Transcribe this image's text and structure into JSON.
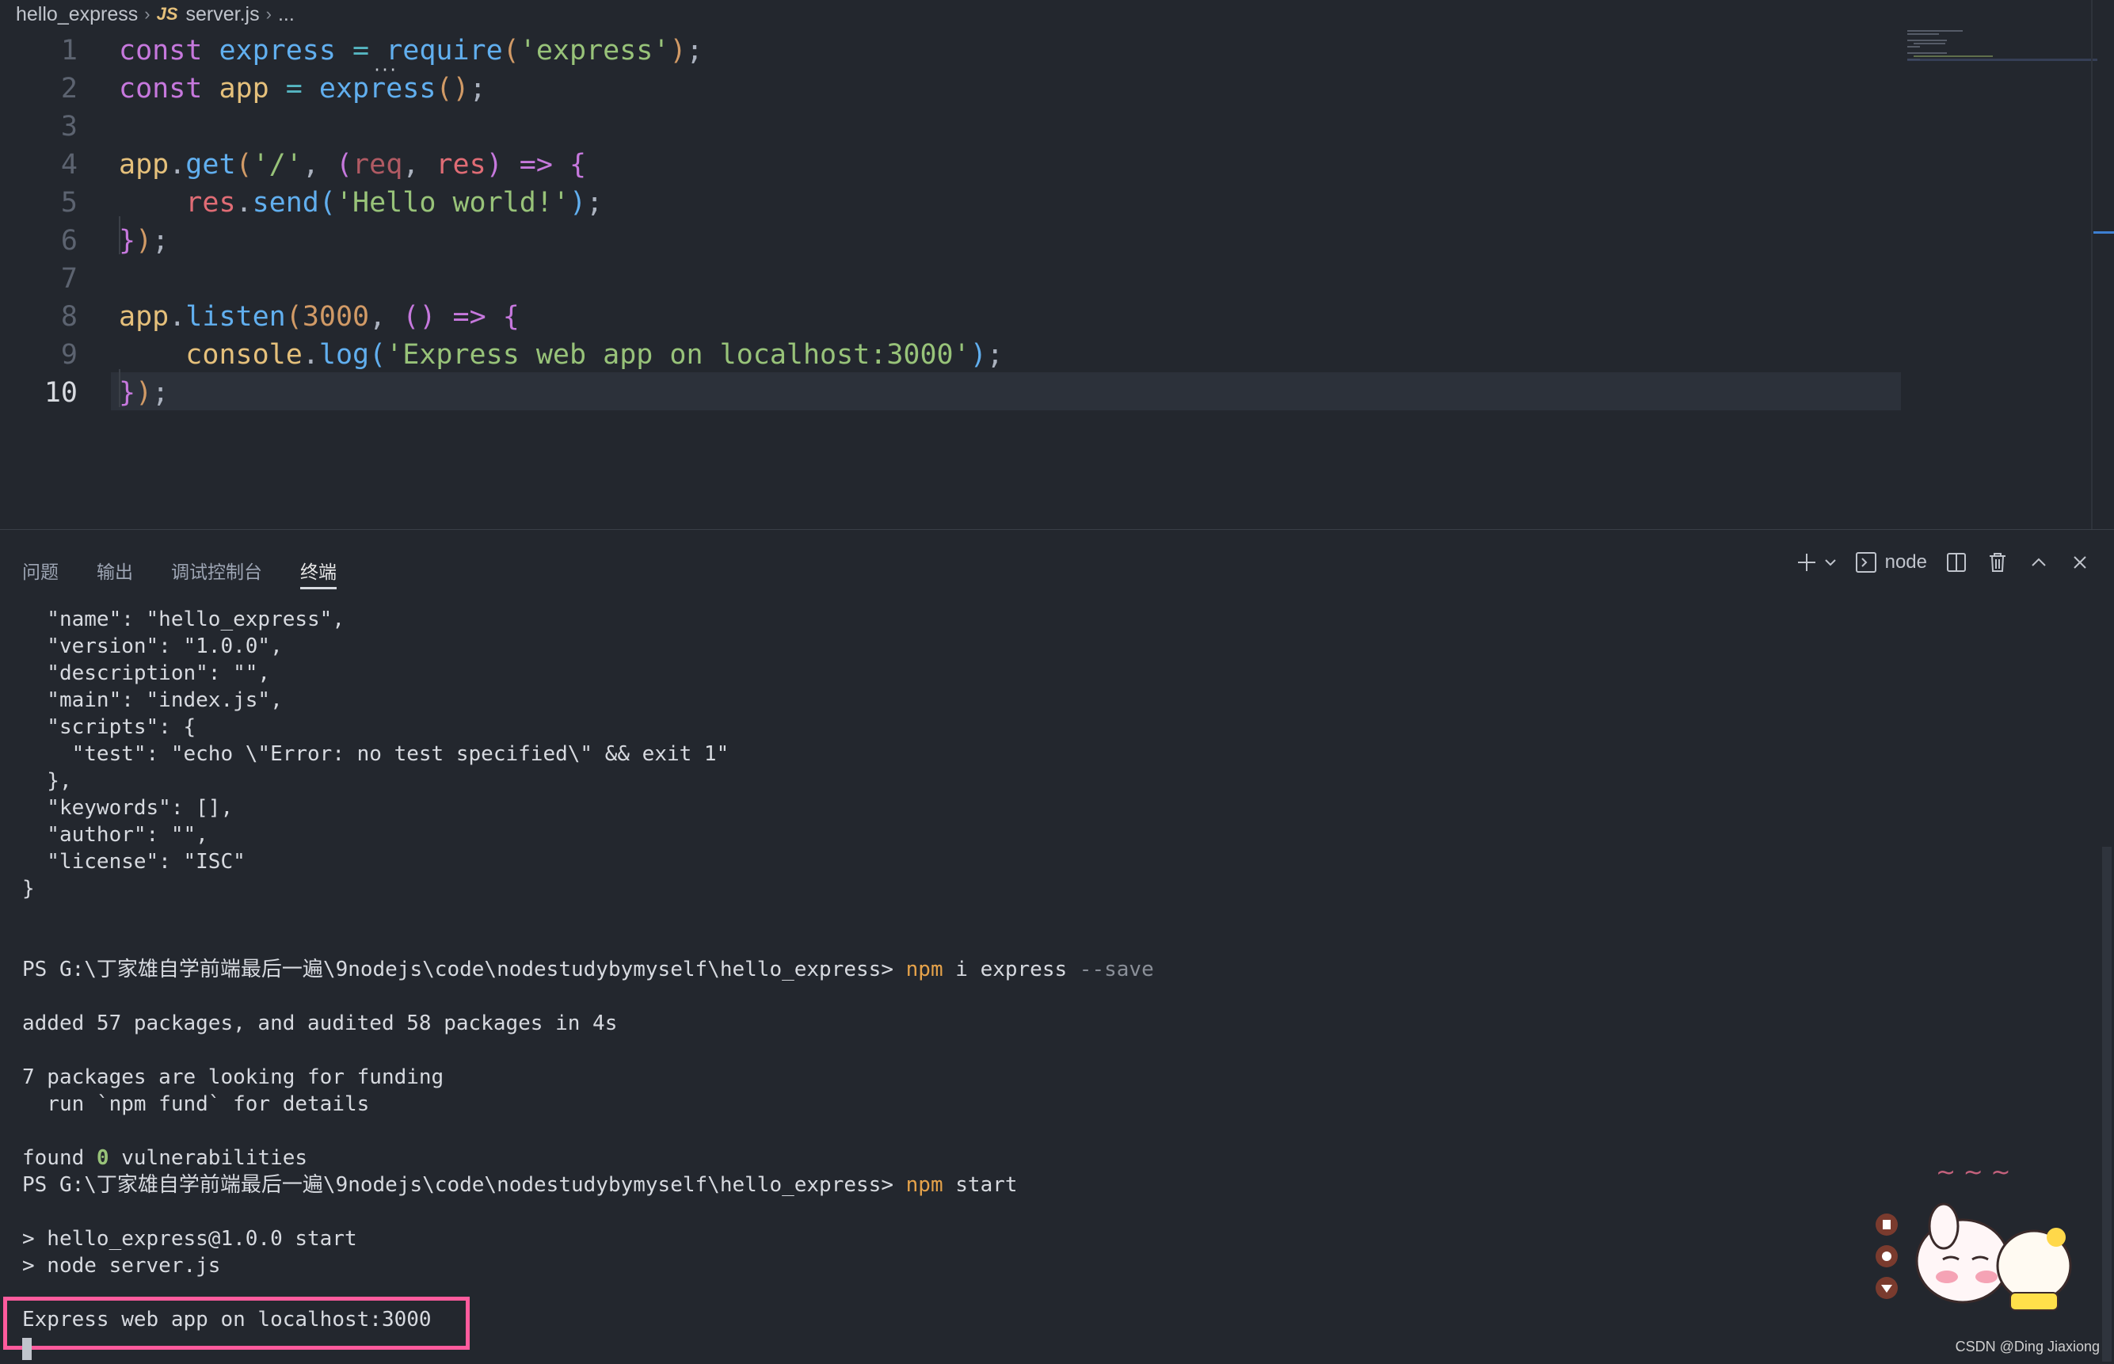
{
  "breadcrumb": {
    "folder": "hello_express",
    "file_icon": "JS",
    "file": "server.js",
    "tail": "..."
  },
  "editor": {
    "lines": [
      "1",
      "2",
      "3",
      "4",
      "5",
      "6",
      "7",
      "8",
      "9",
      "10"
    ],
    "active_line": "10"
  },
  "panel": {
    "tabs": [
      "问题",
      "输出",
      "调试控制台",
      "终端"
    ],
    "active_tab": "终端",
    "shell_label": "node"
  },
  "terminal": {
    "json_lines": [
      "  \"name\": \"hello_express\",",
      "  \"version\": \"1.0.0\",",
      "  \"description\": \"\",",
      "  \"main\": \"index.js\",",
      "  \"scripts\": {",
      "    \"test\": \"echo \\\"Error: no test specified\\\" && exit 1\"",
      "  },",
      "  \"keywords\": [],",
      "  \"author\": \"\",",
      "  \"license\": \"ISC\"",
      "}"
    ],
    "prompt": "PS G:\\丁家雄自学前端最后一遍\\9nodejs\\code\\nodestudybymyself\\hello_express>",
    "cmd1": "npm",
    "cmd1_args": " i express ",
    "cmd1_flag": "--save",
    "added": "added 57 packages, and audited 58 packages in 4s",
    "funding1": "7 packages are looking for funding",
    "funding2": "  run `npm fund` for details",
    "found_pre": "found ",
    "found_num": "0",
    "found_post": " vulnerabilities",
    "cmd2": "npm",
    "cmd2_args": " start",
    "run1": "> hello_express@1.0.0 start",
    "run2": "> node server.js",
    "output": "Express web app on localhost:3000"
  },
  "watermark": "CSDN @Ding Jiaxiong",
  "colors": {
    "highlight": "#ff5b9d",
    "keyword": "#c678dd",
    "string": "#98c379",
    "function": "#61afef"
  }
}
